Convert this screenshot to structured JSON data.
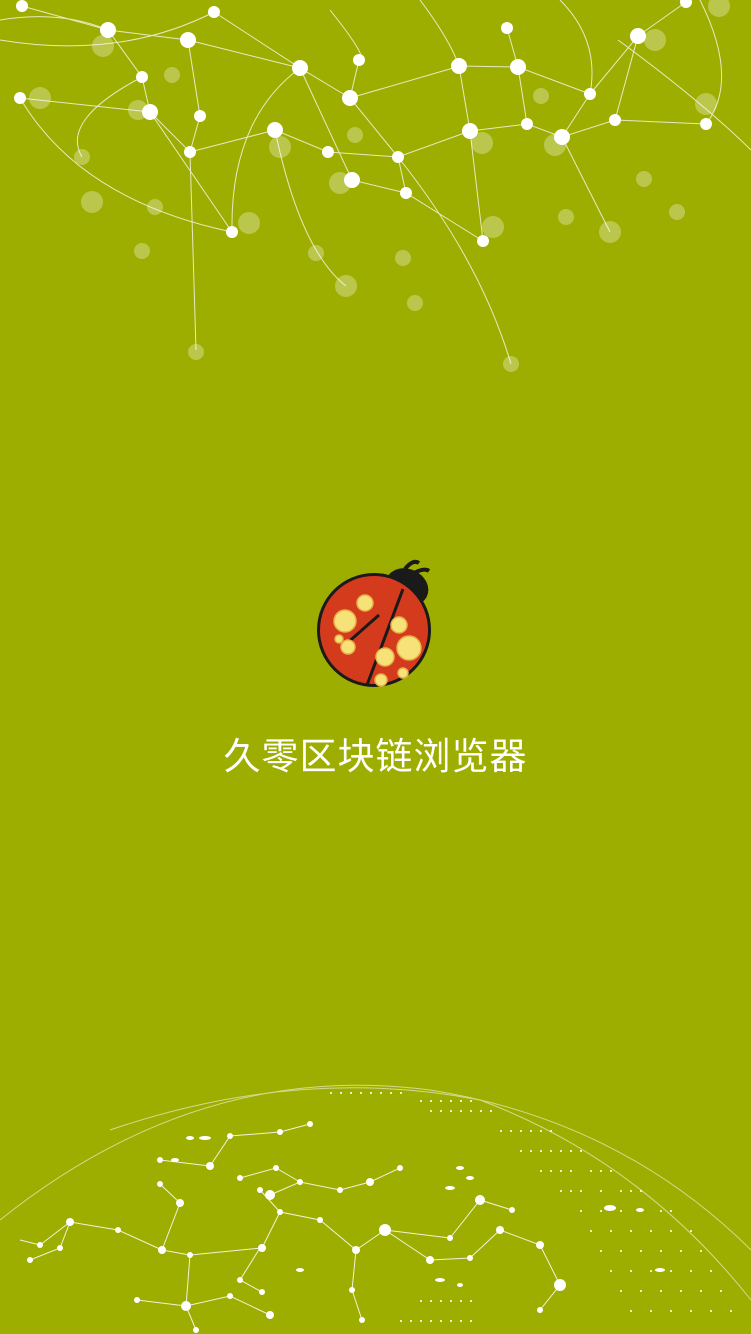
{
  "splash": {
    "app_name": "久零区块链浏览器",
    "logo_icon": "ladybug-icon",
    "top_decoration": "network-nodes-decoration",
    "bottom_decoration": "globe-network-decoration"
  },
  "theme": {
    "background": "#9eae00",
    "text": "#ffffff",
    "ladybug_red": "#d43a1c",
    "ladybug_spots": "#f7e27a",
    "ladybug_black": "#1a1a1a"
  }
}
